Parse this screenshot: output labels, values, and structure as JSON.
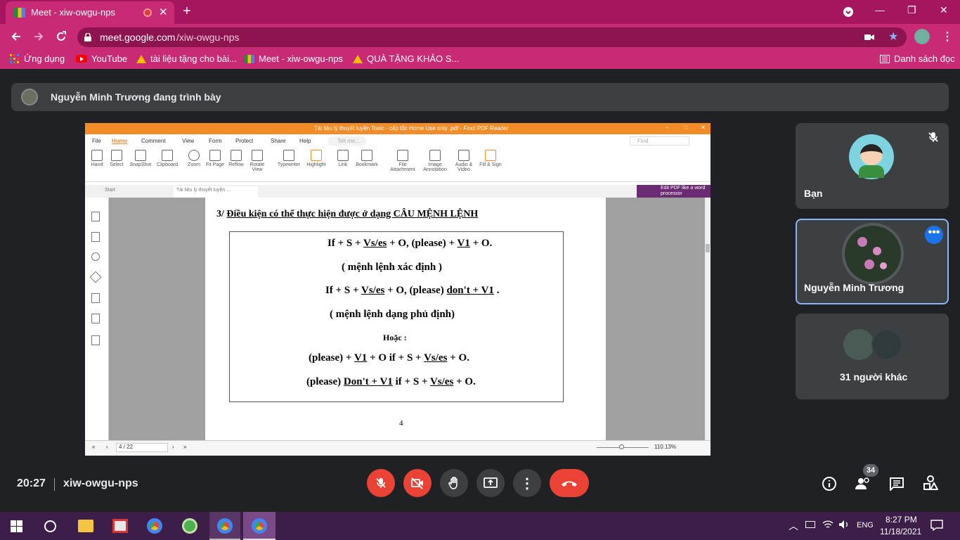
{
  "browser": {
    "tab_title": "Meet - xiw-owgu-nps",
    "url_host": "meet.google.com",
    "url_path": "/xiw-owgu-nps",
    "bookmarks": [
      "Ứng dụng",
      "YouTube",
      "tài liệu tặng cho bài...",
      "Meet - xiw-owgu-nps",
      "QUÀ TẶNG KHẢO S..."
    ],
    "reading_list": "Danh sách đọc"
  },
  "meet": {
    "presenting_text": "Nguyễn Minh Trương đang trình bày",
    "tiles": [
      {
        "name": "Bạn"
      },
      {
        "name": "Nguyễn Minh Trương"
      },
      {
        "name": "31 người khác"
      }
    ],
    "time": "20:27",
    "meeting_code": "xiw-owgu-nps",
    "people_count": "34"
  },
  "foxit": {
    "window_title": "Tài liệu lý thuyết luyện Toeic - cấp tốc Home Use only .pdf - Foxit PDF Reader",
    "menu": [
      "File",
      "Home",
      "Comment",
      "View",
      "Form",
      "Protect",
      "Share",
      "Help"
    ],
    "tell_me": "Tell me...",
    "find": "Find",
    "tools": [
      "Hand",
      "Select",
      "SnapShot",
      "Clipboard",
      "Zoom",
      "Fit Page",
      "Reflow",
      "Rotate View",
      "Typewriter",
      "Highlight",
      "Link",
      "Bookmark",
      "File Attachment",
      "Image Annotation",
      "Audio & Video",
      "Fill & Sign"
    ],
    "doc_tabs": [
      "Start",
      "Tài liệu lý thuyết luyện ..."
    ],
    "edit_promo": "Edit PDF like a word processor",
    "page_nav": "4 / 22",
    "zoom": "110.13%"
  },
  "page": {
    "heading_num": "3/",
    "heading": "Điều kiện có thể thực hiện được ở dạng CÂU MỆNH LỆNH",
    "line1_a": "If + S + ",
    "line1_b": "Vs/es",
    "line1_c": " + O, (please) + ",
    "line1_d": "V1",
    "line1_e": " + O.",
    "line2": "( mệnh lệnh xác định )",
    "line3_a": "If + S + ",
    "line3_b": "Vs/es",
    "line3_c": " + O, (please) ",
    "line3_d": "don't + V1",
    "line3_e": " .",
    "line4": "( mệnh lệnh dạng phủ định)",
    "line5": "Hoặc :",
    "line6_a": "(please) + ",
    "line6_b": "V1",
    "line6_c": " + O if + S + ",
    "line6_d": "Vs/es",
    "line6_e": " + O.",
    "line7_a": "(please) ",
    "line7_b": "Don't + V1",
    "line7_c": " if + S + ",
    "line7_d": "Vs/es",
    "line7_e": " + O.",
    "page_number": "4"
  },
  "taskbar": {
    "time": "8:27 PM",
    "date": "11/18/2021",
    "lang": "ENG"
  }
}
